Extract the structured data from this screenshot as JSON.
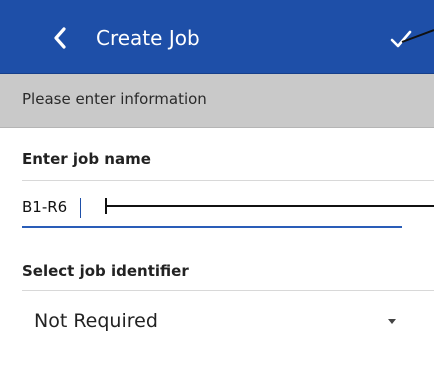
{
  "header": {
    "title": "Create Job",
    "back_icon": "chevron-left-icon",
    "confirm_icon": "check-icon",
    "color": "#1e4fa8"
  },
  "info": {
    "text": "Please enter information",
    "background": "#c9c9c9"
  },
  "job_name": {
    "label": "Enter job name",
    "value": "B1-R6"
  },
  "job_identifier": {
    "label": "Select job identifier",
    "selected": "Not Required"
  }
}
